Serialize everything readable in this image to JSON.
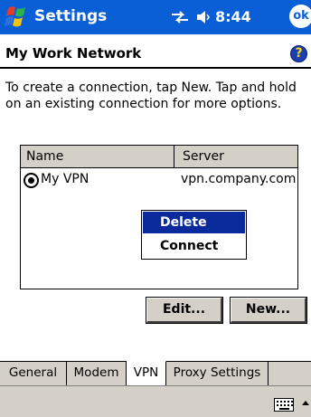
{
  "titlebar": {
    "title": "Settings",
    "time": "8:44",
    "ok_label": "ok",
    "start_icon": "windows-flag-icon",
    "connectivity_icon": "connectivity-icon",
    "volume_icon": "speaker-icon",
    "color": "#0a5fd6"
  },
  "header": {
    "title": "My Work Network",
    "help_label": "?"
  },
  "instructions": "To create a connection, tap New. Tap and hold on an existing connection for more options.",
  "list": {
    "columns": [
      "Name",
      "Server"
    ],
    "rows": [
      {
        "name": "My VPN",
        "server": "vpn.company.com",
        "selected": true
      }
    ]
  },
  "context_menu": {
    "items": [
      "Delete",
      "Connect"
    ],
    "highlighted": "Delete",
    "highlight_color": "#0a2a9c"
  },
  "buttons": {
    "edit": "Edit...",
    "new": "New..."
  },
  "tabs": {
    "items": [
      "General",
      "Modem",
      "VPN",
      "Proxy Settings"
    ],
    "active": "VPN"
  },
  "menubar": {
    "keyboard_icon": "keyboard-icon",
    "sip_arrow": "up-arrow-icon"
  }
}
